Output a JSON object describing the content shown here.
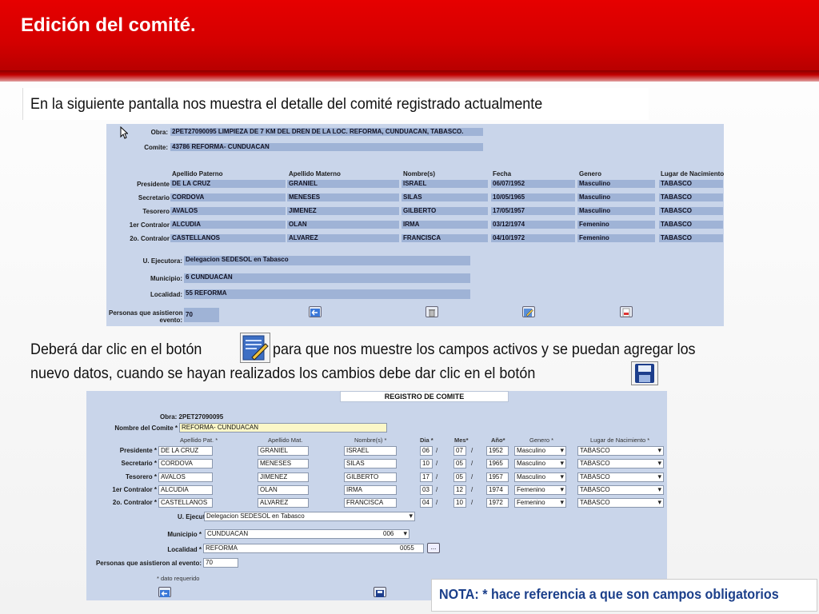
{
  "slide": {
    "title": "Edición del comité.",
    "intro": "En la siguiente pantalla nos muestra el detalle del comité registrado actualmente",
    "mid_line1_a": "Deberá dar clic en el botón",
    "mid_line1_b": "para que nos muestre los campos activos y se puedan agregar los",
    "mid_line2": "nuevo datos, cuando se hayan realizados los cambios debe dar clic en el botón",
    "note": "NOTA: * hace referencia a que son campos obligatorios"
  },
  "detail": {
    "obra_label": "Obra:",
    "obra_value": "2PET27090095 LIMPIEZA DE 7 KM DEL DREN DE LA LOC. REFORMA, CUNDUACAN, TABASCO.",
    "comite_label": "Comite:",
    "comite_value": "43786 REFORMA- CUNDUACAN",
    "headers": [
      "Apellido Paterno",
      "Apellido Materno",
      "Nombre(s)",
      "Fecha",
      "Genero",
      "Lugar de Nacimiento"
    ],
    "rows": [
      {
        "role": "Presidente",
        "ap": "DE LA CRUZ",
        "am": "GRANIEL",
        "nom": "ISRAEL",
        "fecha": "06/07/1952",
        "gen": "Masculino",
        "lugar": "TABASCO"
      },
      {
        "role": "Secretario",
        "ap": "CORDOVA",
        "am": "MENESES",
        "nom": "SILAS",
        "fecha": "10/05/1965",
        "gen": "Masculino",
        "lugar": "TABASCO"
      },
      {
        "role": "Tesorero",
        "ap": "AVALOS",
        "am": "JIMENEZ",
        "nom": "GILBERTO",
        "fecha": "17/05/1957",
        "gen": "Masculino",
        "lugar": "TABASCO"
      },
      {
        "role": "1er Contralor",
        "ap": "ALCUDIA",
        "am": "OLAN",
        "nom": "IRMA",
        "fecha": "03/12/1974",
        "gen": "Femenino",
        "lugar": "TABASCO"
      },
      {
        "role": "2o. Contralor",
        "ap": "CASTELLANOS",
        "am": "ALVAREZ",
        "nom": "FRANCISCA",
        "fecha": "04/10/1972",
        "gen": "Femenino",
        "lugar": "TABASCO"
      }
    ],
    "ejecutora_label": "U. Ejecutora:",
    "ejecutora_value": "Delegacion SEDESOL en Tabasco",
    "municipio_label": "Municipio:",
    "municipio_value": "6 CUNDUACÁN",
    "localidad_label": "Localidad:",
    "localidad_value": "55 REFORMA",
    "personas_label_1": "Personas que asistieron al",
    "personas_label_2": "evento:",
    "personas_value": "70"
  },
  "form": {
    "header": "REGISTRO DE COMITE",
    "obra_label": "Obra: 2PET27090095",
    "nombre_label": "Nombre del Comite *",
    "nombre_value": "REFORMA- CUNDUACAN",
    "headers": {
      "ap": "Apellido Pat. *",
      "am": "Apellido Mat.",
      "nom": "Nombre(s) *",
      "dia": "Dia *",
      "mes": "Mes*",
      "anio": "Año*",
      "gen": "Genero *",
      "lugar": "Lugar de Nacimiento *"
    },
    "rows": [
      {
        "role": "Presidente *",
        "ap": "DE LA CRUZ",
        "am": "GRANIEL",
        "nom": "ISRAEL",
        "dia": "06",
        "mes": "07",
        "anio": "1952",
        "gen": "Masculino",
        "lugar": "TABASCO"
      },
      {
        "role": "Secretario *",
        "ap": "CORDOVA",
        "am": "MENESES",
        "nom": "SILAS",
        "dia": "10",
        "mes": "05",
        "anio": "1965",
        "gen": "Masculino",
        "lugar": "TABASCO"
      },
      {
        "role": "Tesorero *",
        "ap": "AVALOS",
        "am": "JIMENEZ",
        "nom": "GILBERTO",
        "dia": "17",
        "mes": "05",
        "anio": "1957",
        "gen": "Masculino",
        "lugar": "TABASCO"
      },
      {
        "role": "1er Contralor *",
        "ap": "ALCUDIA",
        "am": "OLAN",
        "nom": "IRMA",
        "dia": "03",
        "mes": "12",
        "anio": "1974",
        "gen": "Femenino",
        "lugar": "TABASCO"
      },
      {
        "role": "2o. Contralor *",
        "ap": "CASTELLANOS",
        "am": "ALVAREZ",
        "nom": "FRANCISCA",
        "dia": "04",
        "mes": "10",
        "anio": "1972",
        "gen": "Femenino",
        "lugar": "TABASCO"
      }
    ],
    "date_sep": "/",
    "ejecutora_label": "U.  Ejecutora",
    "ejecutora_value": "Delegacion SEDESOL en Tabasco",
    "municipio_label": "Municipio *",
    "municipio_value": "CUNDUACAN",
    "municipio_code": "006",
    "localidad_label": "Localidad *",
    "localidad_value": "REFORMA",
    "localidad_code": "0055",
    "lookup_label": "...",
    "personas_label": "Personas que asistieron al evento:",
    "personas_value": "70",
    "requerido": "* dato requerido"
  },
  "colors": {
    "banner": "#d40000",
    "panel": "#c9d5ea",
    "field": "#9fb3d6",
    "note": "#1b3f8a"
  }
}
